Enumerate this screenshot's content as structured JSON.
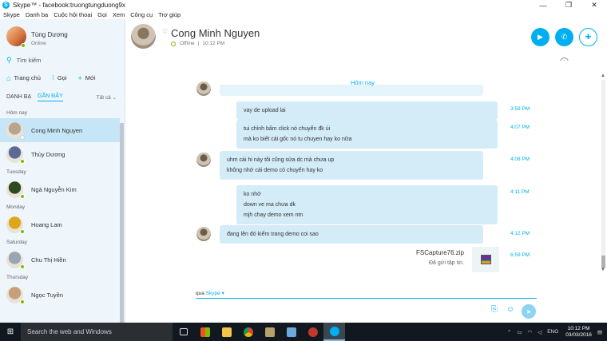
{
  "window": {
    "title": "Skype™ - facebook:truongtungduong9x",
    "controls": [
      "—",
      "❐",
      "✕"
    ]
  },
  "menu": [
    "Skype",
    "Danh bạ",
    "Cuộc hội thoại",
    "Gọi",
    "Xem",
    "Công cụ",
    "Trợ giúp"
  ],
  "profile": {
    "name": "Tùng Dương",
    "status": "Online"
  },
  "search": {
    "label": "Tìm kiếm"
  },
  "nav": {
    "home": "Trang chủ",
    "call": "Gọi",
    "new": "Mới"
  },
  "tabs": {
    "contacts": "DANH BẠ",
    "recent": "GẦN ĐÂY",
    "filter": "Tất cả"
  },
  "contacts": [
    {
      "section": "Hôm nay",
      "name": "Cong Minh Nguyen",
      "selected": true,
      "color": "#b9a58d",
      "presence": "offline"
    },
    {
      "section": "",
      "name": "Thùy Dương",
      "selected": false,
      "color": "#5a6a95",
      "presence": "online"
    },
    {
      "section": "Tuesday",
      "name": "Ngà Nguyễn Kim",
      "selected": false,
      "color": "#2f4a1f",
      "presence": "online"
    },
    {
      "section": "Monday",
      "name": "Hoang Lam",
      "selected": false,
      "color": "#e0a61a",
      "presence": "online"
    },
    {
      "section": "Saturday",
      "name": "Chu Thị Hiền",
      "selected": false,
      "color": "#9aa6b4",
      "presence": "online"
    },
    {
      "section": "Thursday",
      "name": "Ngọc Tuyền",
      "selected": false,
      "color": "#c7a07b",
      "presence": "online"
    }
  ],
  "conversation": {
    "name": "Cong Minh Nguyen",
    "status": "Offline",
    "last_seen": "10:12 PM",
    "day_label": "Hôm nay",
    "composer_via": "qua",
    "composer_service": "Skype"
  },
  "messages": [
    {
      "lines": [
        "vay de upload lai"
      ],
      "time": "3:59 PM"
    },
    {
      "lines": [
        "tui chỉnh bấm click nó chuyển đk úi",
        "mà ko biết cái gốc nó tu chuyen hay ko nữa"
      ],
      "time": "4:07 PM"
    },
    {
      "lines": [
        "uhm cái hi này tôi cũng sửa dc mà chưa up",
        "không nhớ cái demo có chuyển hay ko"
      ],
      "time": "4:08 PM"
    },
    {
      "lines": [
        "ko nhớ",
        "down ve ma chưa dk",
        "mjh chay demo xem ntn"
      ],
      "time": "4:11 PM"
    },
    {
      "lines": [
        "đang lên đó kiếm trang demo coi sao"
      ],
      "time": "4:12 PM"
    }
  ],
  "file": {
    "name": "FSCapture76.zip",
    "status": "Đã gửi tập tin.",
    "time": "6:59 PM"
  },
  "taskbar": {
    "search_placeholder": "Search the web and Windows",
    "lang": "ENG",
    "time": "10:12 PM",
    "date": "03/03/2016"
  }
}
